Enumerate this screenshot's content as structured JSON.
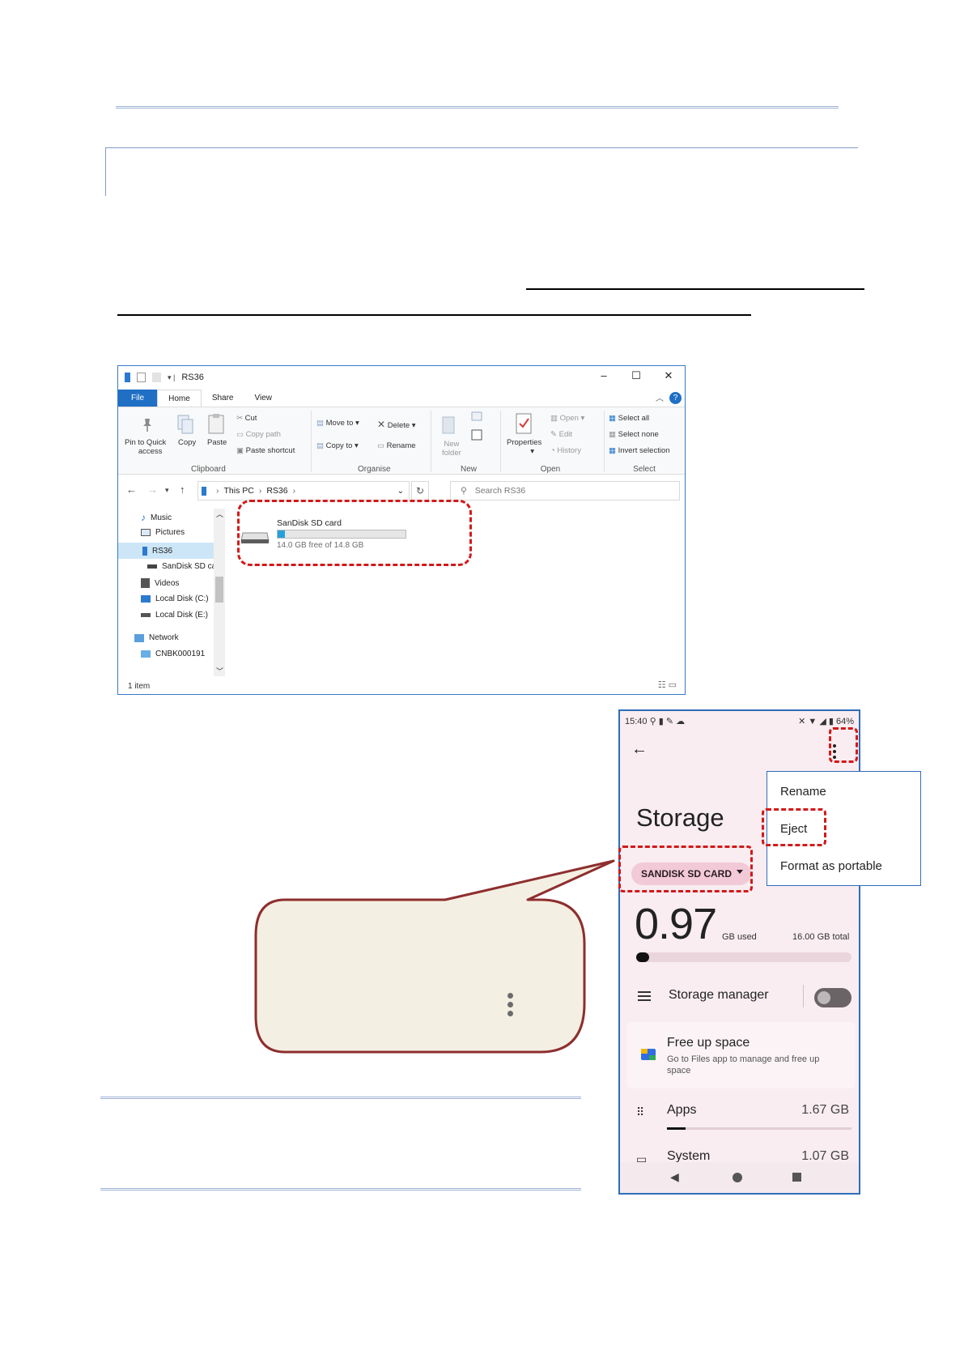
{
  "explorer": {
    "window_title": "RS36",
    "tabs": [
      "File",
      "Home",
      "Share",
      "View"
    ],
    "ribbon": {
      "clipboard": {
        "pin_label_1": "Pin to Quick",
        "pin_label_2": "access",
        "copy": "Copy",
        "paste": "Paste",
        "cut": "Cut",
        "copy_path": "Copy path",
        "paste_shortcut": "Paste shortcut",
        "group": "Clipboard"
      },
      "organise": {
        "move_to": "Move to",
        "copy_to": "Copy to",
        "delete": "Delete",
        "rename": "Rename",
        "group": "Organise"
      },
      "new": {
        "new_folder_1": "New",
        "new_folder_2": "folder",
        "group": "New"
      },
      "open": {
        "properties": "Properties",
        "open": "Open",
        "edit": "Edit",
        "history": "History",
        "group": "Open"
      },
      "select": {
        "select_all": "Select all",
        "select_none": "Select none",
        "invert_selection": "Invert selection",
        "group": "Select"
      }
    },
    "breadcrumb": [
      "This PC",
      "RS36"
    ],
    "search_placeholder": "Search RS36",
    "nav_items": [
      "Music",
      "Pictures",
      "RS36",
      "SanDisk SD car",
      "Videos",
      "Local Disk (C:)",
      "Local Disk (E:)",
      "Network",
      "CNBK000191"
    ],
    "drive": {
      "name": "SanDisk SD card",
      "free_text": "14.0 GB free of  14.8 GB",
      "used_fraction": 0.054
    },
    "status": "1 item"
  },
  "phone": {
    "status_time": "15:40",
    "battery": "64%",
    "title": "Storage",
    "volume_chip": "SANDISK SD CARD",
    "used_value": "0.97",
    "used_unit": "GB used",
    "total": "16.00 GB total",
    "used_fraction": 0.06,
    "storage_manager": "Storage manager",
    "storage_manager_enabled": false,
    "free_up_title": "Free up space",
    "free_up_desc": "Go to Files app to manage and free up space",
    "apps_label": "Apps",
    "apps_value": "1.67 GB",
    "apps_fraction": 0.1,
    "system_label": "System",
    "system_value": "1.07 GB"
  },
  "menu": {
    "items": [
      "Rename",
      "Eject",
      "Format as portable"
    ]
  },
  "colors": {
    "highlight": "#d11a1a",
    "explorer_accent": "#1f6fc5",
    "callout_fill": "#f4efe3",
    "callout_border": "#8e2e2e"
  }
}
